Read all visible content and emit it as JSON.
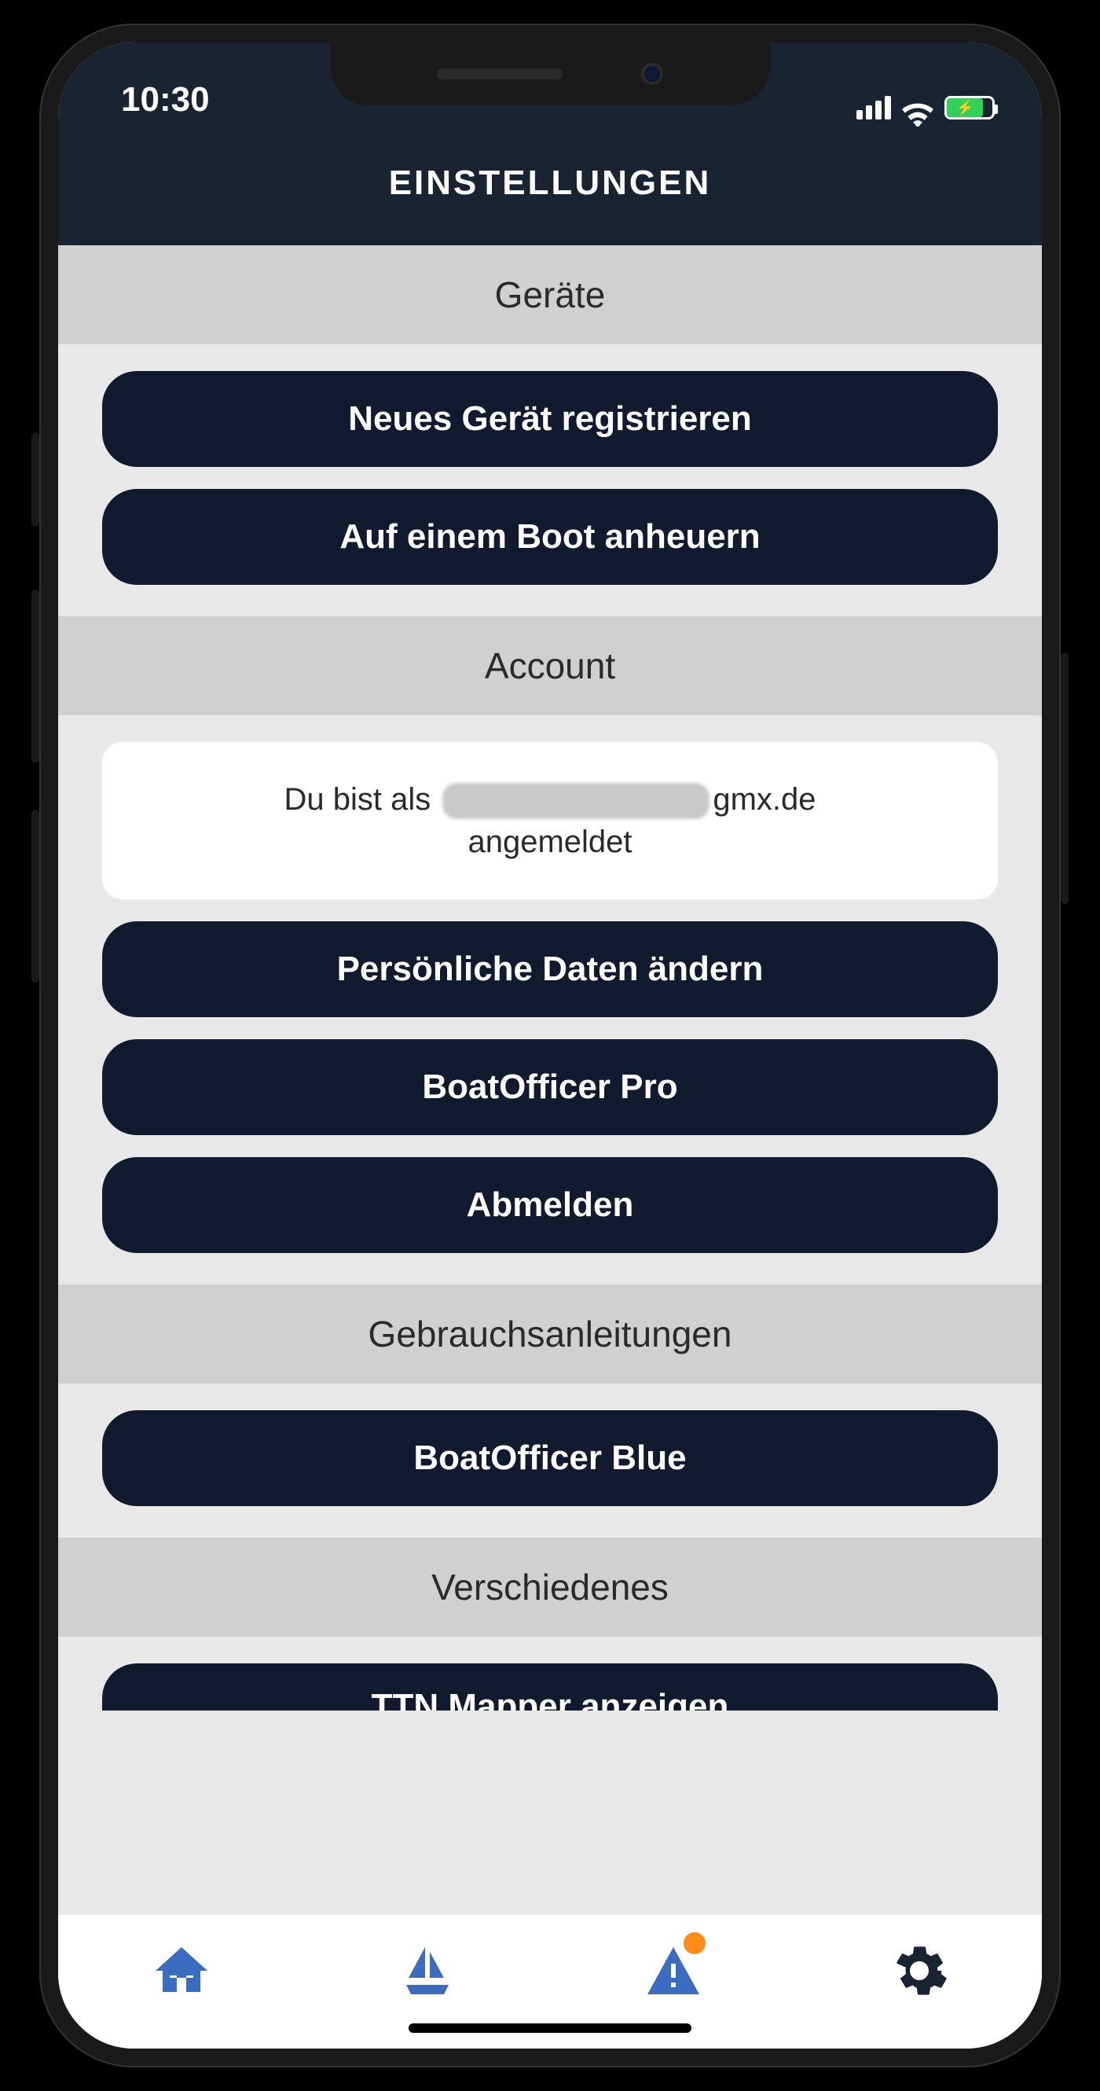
{
  "status": {
    "time": "10:30"
  },
  "header": {
    "title": "EINSTELLUNGEN"
  },
  "sections": {
    "devices": {
      "title": "Geräte",
      "register_btn": "Neues Gerät registrieren",
      "signon_btn": "Auf einem Boot anheuern"
    },
    "account": {
      "title": "Account",
      "loggedin_prefix": "Du bist als",
      "loggedin_email_visible_suffix": "gmx.de",
      "loggedin_suffix": "angemeldet",
      "personal_btn": "Persönliche Daten ändern",
      "pro_btn": "BoatOfficer Pro",
      "logout_btn": "Abmelden"
    },
    "manuals": {
      "title": "Gebrauchsanleitungen",
      "blue_btn": "BoatOfficer Blue"
    },
    "misc": {
      "title": "Verschiedenes",
      "ttn_btn": "TTN Mapper anzeigen"
    }
  },
  "nav": {
    "home": "Home",
    "boat": "Boote",
    "alerts": "Alarme",
    "settings": "Einstellungen"
  },
  "colors": {
    "button_bg": "#111a2e",
    "header_bg": "#1a2332",
    "nav_active": "#3a6cc0",
    "badge": "#ff8c1a"
  }
}
